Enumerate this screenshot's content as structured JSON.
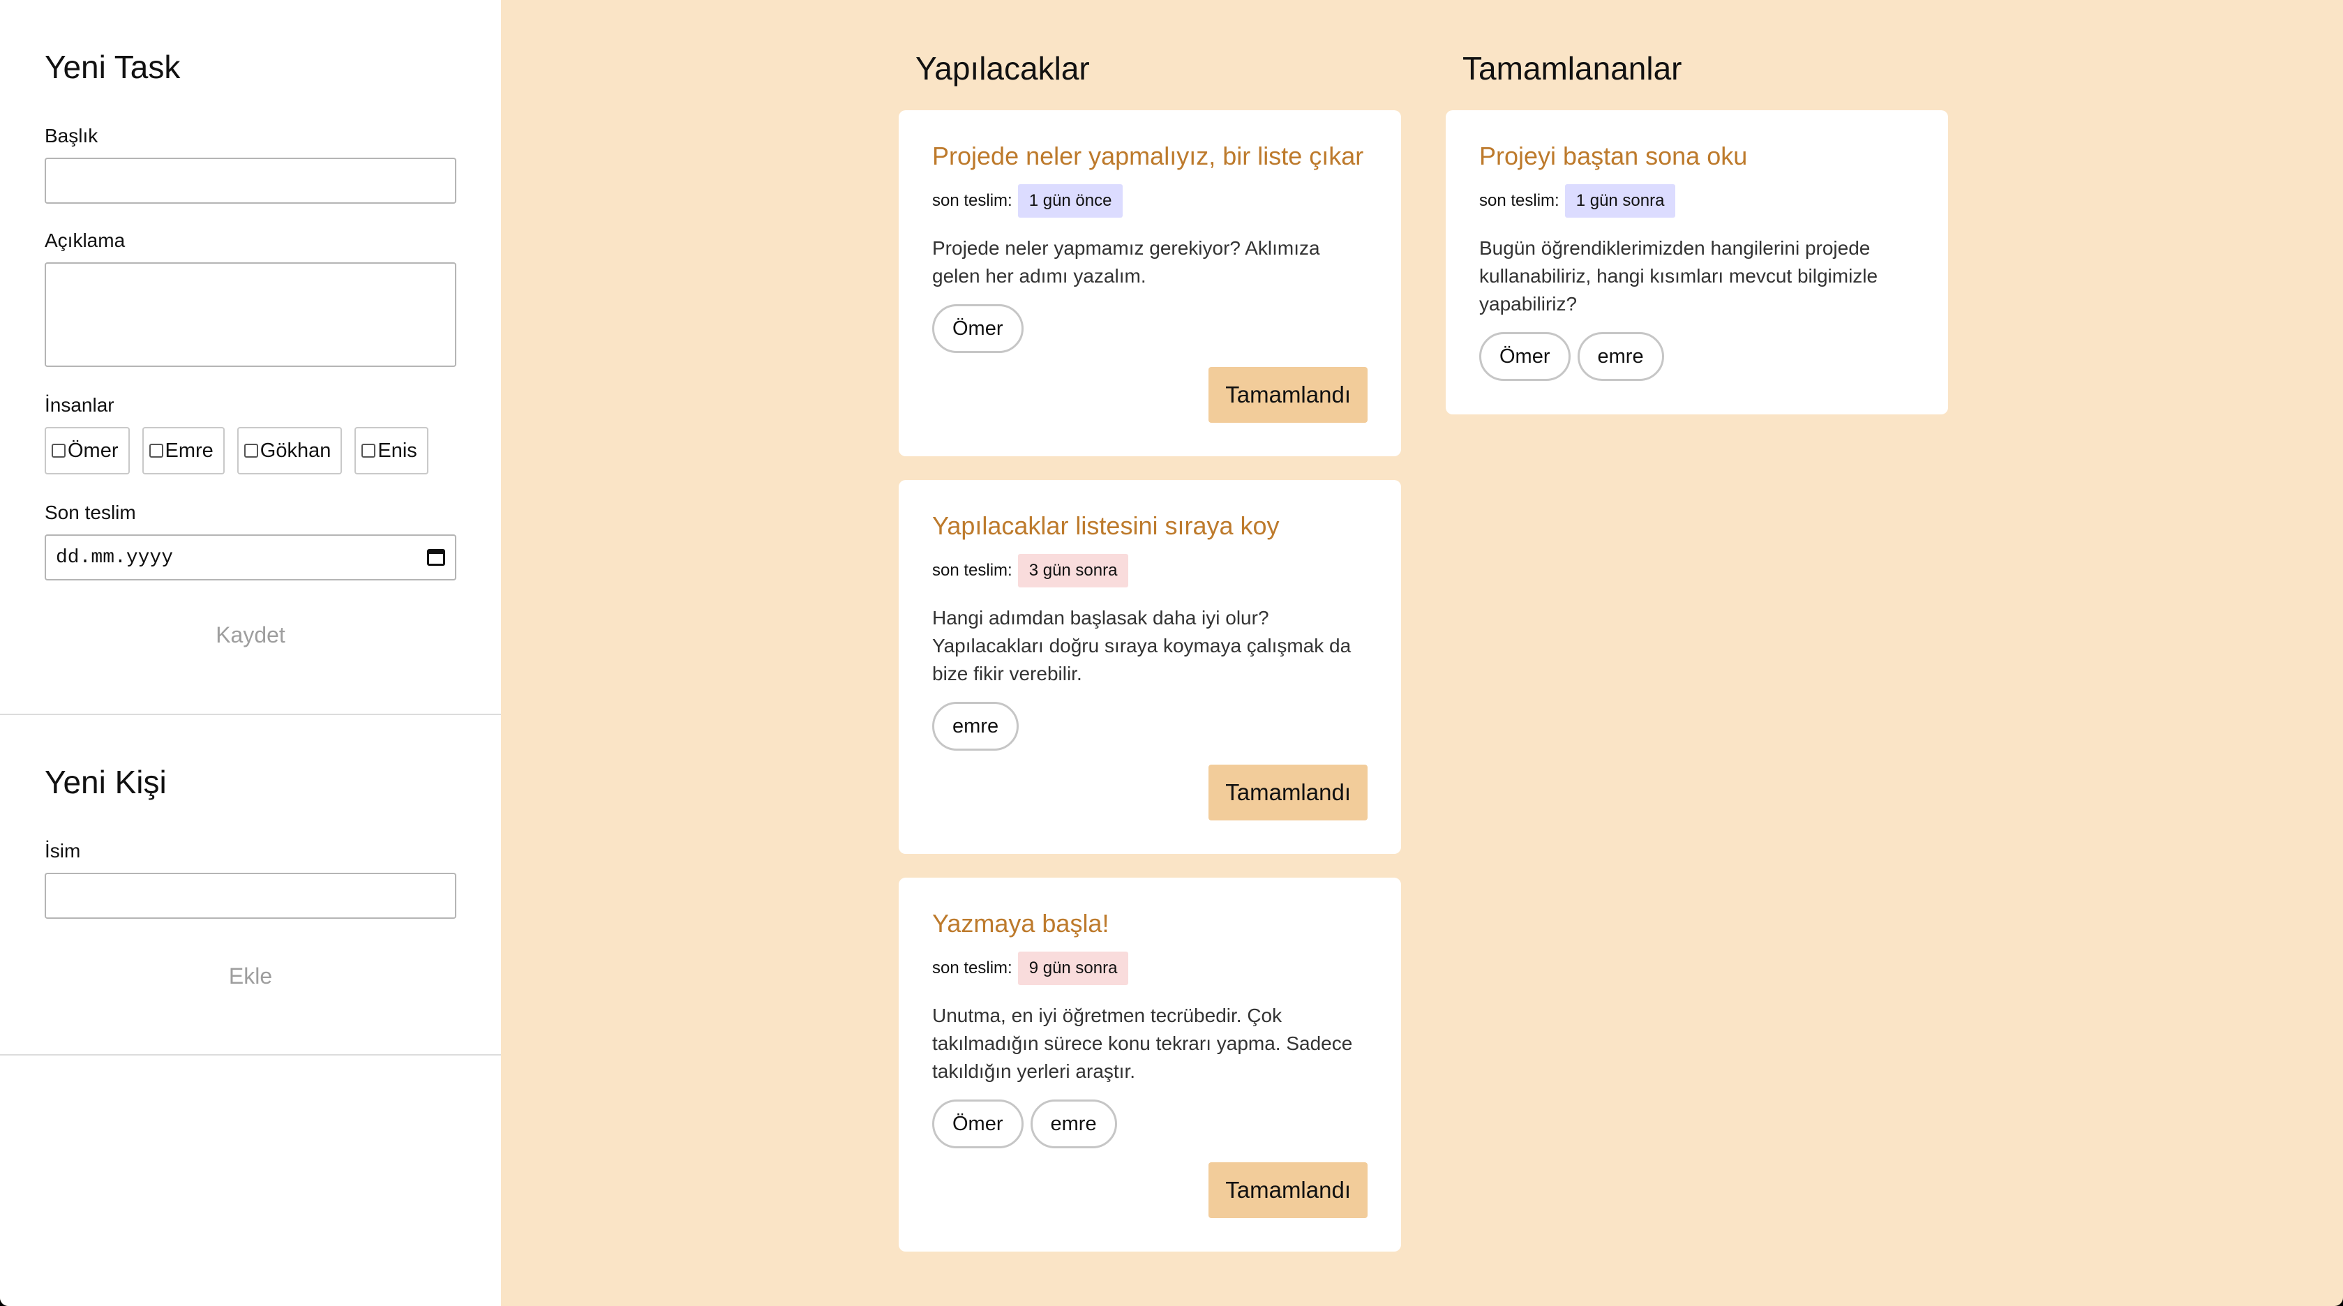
{
  "new_task": {
    "heading": "Yeni Task",
    "title_label": "Başlık",
    "title_value": "",
    "description_label": "Açıklama",
    "description_value": "",
    "people_label": "İnsanlar",
    "people": [
      "Ömer",
      "Emre",
      "Gökhan",
      "Enis"
    ],
    "deadline_label": "Son teslim",
    "deadline_placeholder": "dd.mm.yyyy",
    "save_label": "Kaydet"
  },
  "new_person": {
    "heading": "Yeni Kişi",
    "name_label": "İsim",
    "name_value": "",
    "add_label": "Ekle"
  },
  "columns": {
    "todo_heading": "Yapılacaklar",
    "done_heading": "Tamamlananlar"
  },
  "deadline_prefix": "son teslim:",
  "complete_label": "Tamamlandı",
  "todo": [
    {
      "title": "Projede neler yapmalıyız, bir liste çıkar",
      "deadline": "1 gün önce",
      "description": "Projede neler yapmamız gerekiyor? Aklımıza gelen her adımı yazalım.",
      "assignees": [
        "Ömer"
      ]
    },
    {
      "title": "Yapılacaklar listesini sıraya koy",
      "deadline": "3 gün sonra",
      "description": "Hangi adımdan başlasak daha iyi olur? Yapılacakları doğru sıraya koymaya çalışmak da bize fikir verebilir.",
      "assignees": [
        "emre"
      ]
    },
    {
      "title": "Yazmaya başla!",
      "deadline": "9 gün sonra",
      "description": "Unutma, en iyi öğretmen tecrübedir. Çok takılmadığın sürece konu tekrarı yapma. Sadece takıldığın yerleri araştır.",
      "assignees": [
        "Ömer",
        "emre"
      ]
    }
  ],
  "done": [
    {
      "title": "Projeyi baştan sona oku",
      "deadline": "1 gün sonra",
      "description": "Bugün öğrendiklerimizden hangilerini projede kullanabiliriz, hangi kısımları mevcut bilgimizle yapabiliriz?",
      "assignees": [
        "Ömer",
        "emre"
      ]
    }
  ],
  "colors": {
    "board_background": "#fae4c6",
    "card_title": "#bd7a2c",
    "complete_button": "#f2cc9a",
    "badge_past": "#dcdcff",
    "badge_future": "#f9dcdc"
  },
  "icons": {
    "date_picker": "calendar-icon"
  }
}
